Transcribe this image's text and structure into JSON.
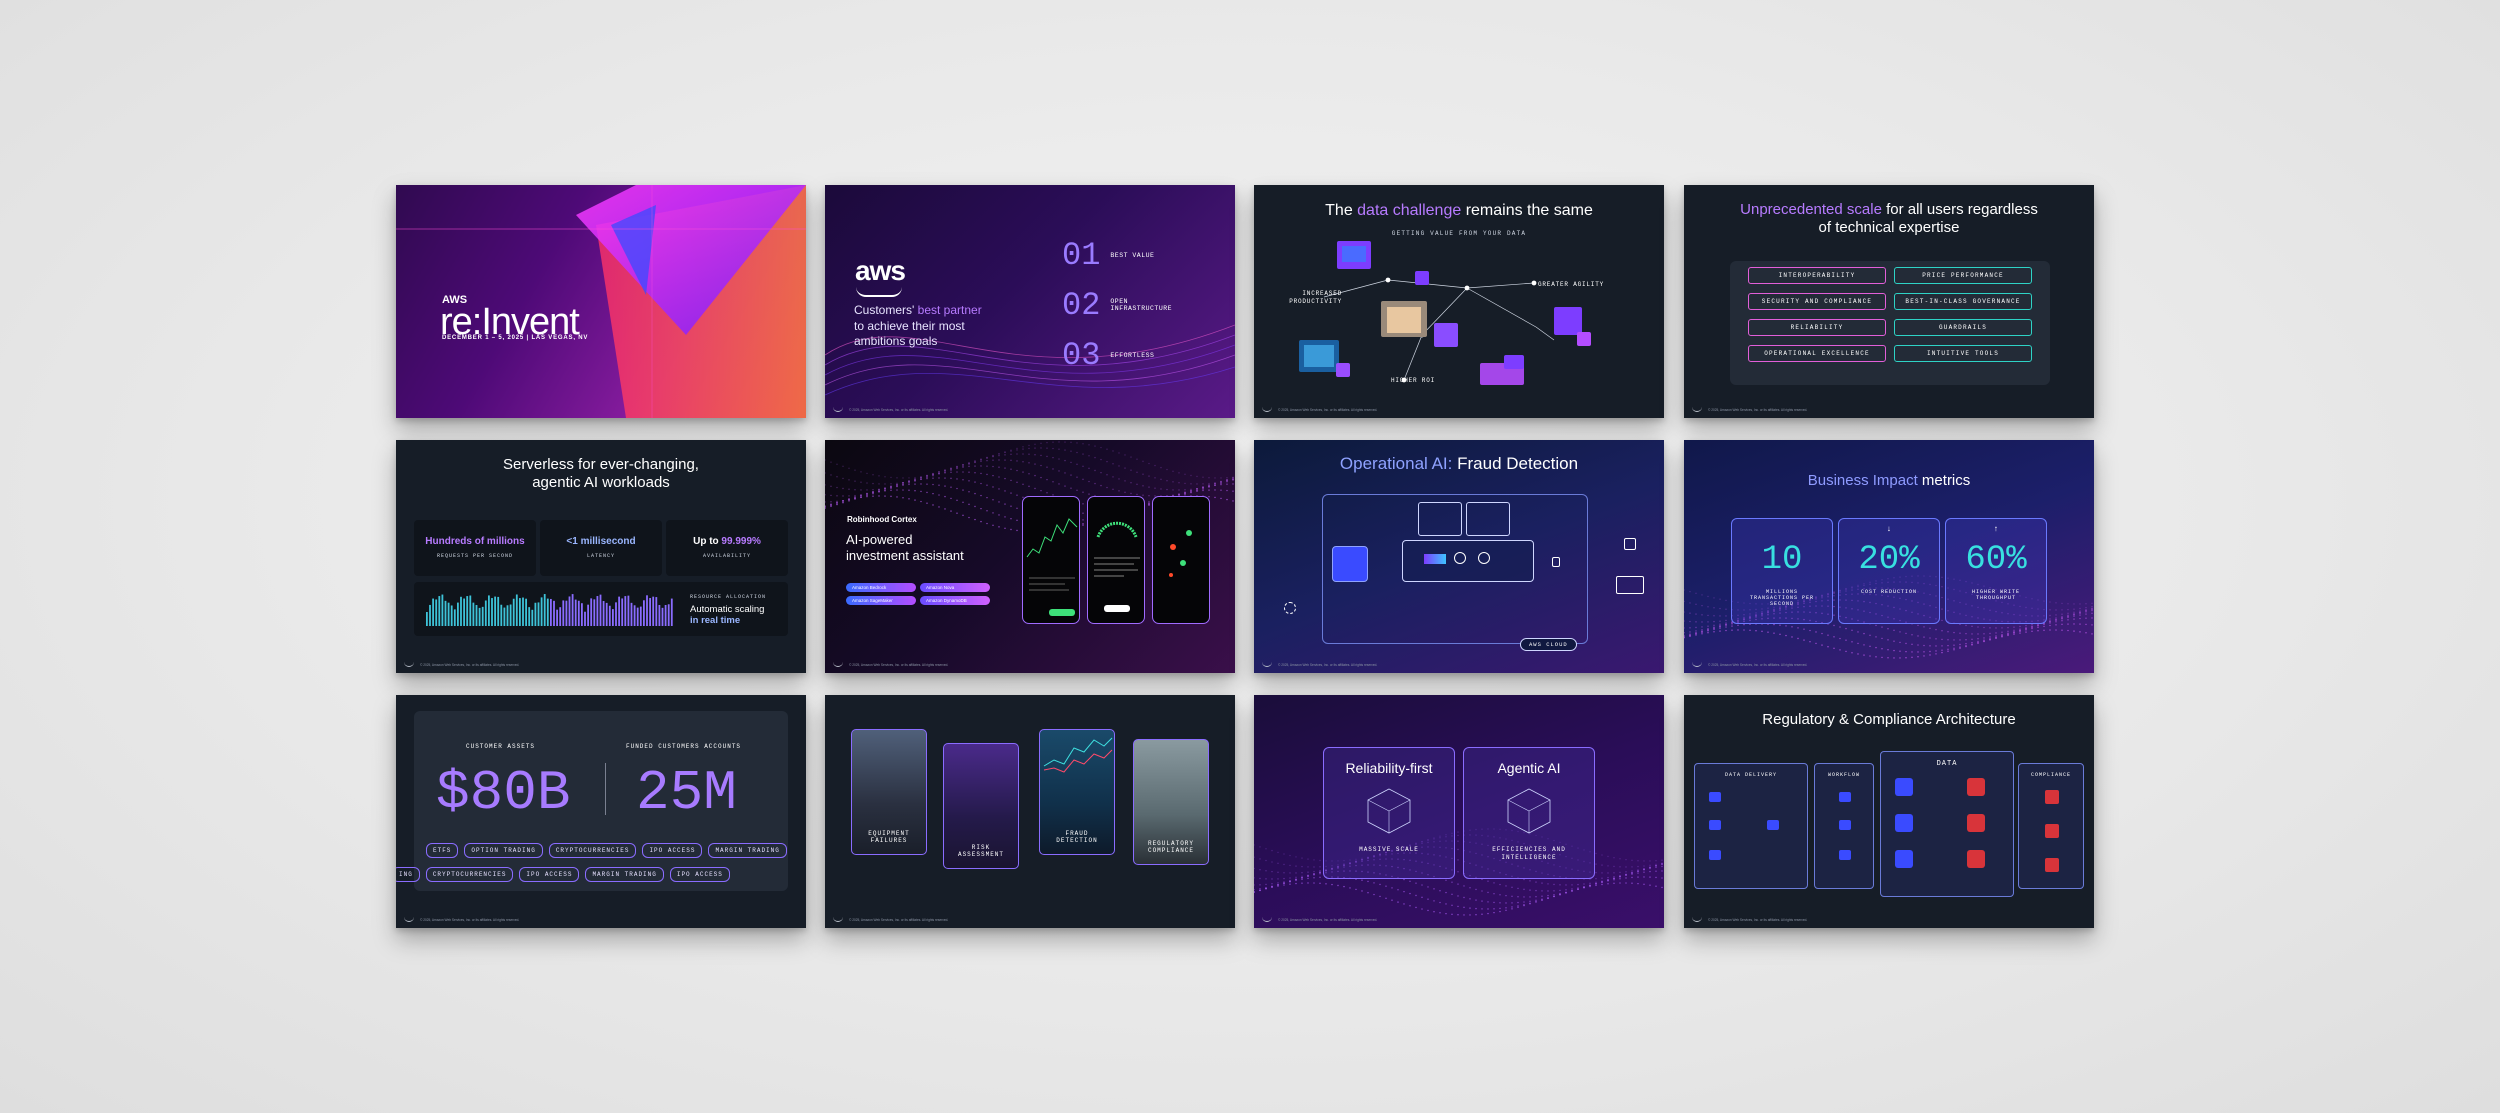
{
  "s1": {
    "aws": "AWS",
    "brand": "re:Invent",
    "event": "DECEMBER 1 – 5, 2025 | LAS VEGAS, NV"
  },
  "s2": {
    "logo": "aws",
    "line1a": "Customers'",
    "line1b": " best partner",
    "line2": "to achieve their most",
    "line3": "ambitions goals",
    "items": [
      {
        "num": "01",
        "label": "BEST VALUE"
      },
      {
        "num": "02",
        "label": "OPEN INFRASTRUCTURE"
      },
      {
        "num": "03",
        "label": "EFFORTLESS"
      }
    ]
  },
  "s3": {
    "title_a": "The ",
    "title_b": "data challenge",
    "title_c": " remains the same",
    "subtitle": "GETTING VALUE FROM YOUR DATA",
    "l1": "INCREASED PRODUCTIVITY",
    "l2": "GREATER AGILITY",
    "l3": "HIGHER ROI"
  },
  "s4": {
    "title_a": "Unprecedented scale",
    "title_b": " for all users regardless",
    "title_c": "of technical expertise",
    "left": [
      "INTEROPERABILITY",
      "SECURITY AND COMPLIANCE",
      "RELIABILITY",
      "OPERATIONAL EXCELLENCE"
    ],
    "right": [
      "PRICE PERFORMANCE",
      "BEST-IN-CLASS GOVERNANCE",
      "GUARDRAILS",
      "INTUITIVE TOOLS"
    ]
  },
  "s5": {
    "title1": "Serverless for ever-changing,",
    "title2": "agentic AI workloads",
    "stats": [
      {
        "value": "Hundreds of millions",
        "label": "REQUESTS PER SECOND"
      },
      {
        "value": "<1 millisecond",
        "label": "LATENCY"
      },
      {
        "value_a": "Up to ",
        "value_b": "99.999%",
        "label": "AVAILABILITY"
      }
    ],
    "res_label": "RESOURCE ALLOCATION",
    "res_1": "Automatic scaling",
    "res_2": "in real time"
  },
  "s6": {
    "brand": "Robinhood Cortex",
    "title1": "AI-powered",
    "title2": "investment assistant",
    "tags": [
      "Amazon Bedrock",
      "Amazon Nova",
      "Amazon SageMaker",
      "Amazon DynamoDB"
    ]
  },
  "s7": {
    "title_a": "Operational AI:",
    "title_b": " Fraud Detection",
    "badge": "AWS CLOUD"
  },
  "s8": {
    "title_a": "Business Impact",
    "title_b": " metrics",
    "metrics": [
      {
        "value": "10",
        "arrow": "",
        "label": "MILLIONS TRANSACTIONS PER SECOND"
      },
      {
        "value": "20%",
        "arrow": "↓",
        "label": "COST REDUCTION"
      },
      {
        "value": "60%",
        "arrow": "↑",
        "label": "HIGHER WRITE THROUGHPUT"
      }
    ]
  },
  "s9": {
    "h1": "CUSTOMER ASSETS",
    "h2": "FUNDED CUSTOMERS ACCOUNTS",
    "v1": "$80B",
    "v2": "25M",
    "row1": [
      "ETFS",
      "OPTION TRADING",
      "CRYPTOCURRENCIES",
      "IPO ACCESS",
      "MARGIN TRADING"
    ],
    "row2": [
      "ING",
      "CRYPTOCURRENCIES",
      "IPO ACCESS",
      "MARGIN TRADING",
      "IPO ACCESS"
    ]
  },
  "s10": {
    "cards": [
      "EQUIPMENT FAILURES",
      "RISK ASSESSMENT",
      "FRAUD DETECTION",
      "REGULATORY COMPLIANCE"
    ]
  },
  "s11": {
    "c1_title": "Reliability-first",
    "c1_label": "MASSIVE SCALE",
    "c2_title": "Agentic AI",
    "c2_label": "EFFICIENCIES AND INTELLIGENCE"
  },
  "s12": {
    "title": "Regulatory & Compliance Architecture",
    "cols": [
      "DATA DELIVERY",
      "WORKFLOW",
      "DATA",
      "COMPLIANCE"
    ]
  },
  "footer": "© 2025, Amazon Web Services, Inc. or its affiliates. All rights reserved."
}
